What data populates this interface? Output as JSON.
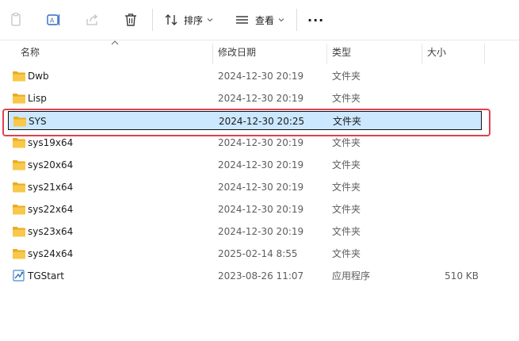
{
  "toolbar": {
    "copy_icon": "clipboard-icon",
    "rename_icon": "rename-icon",
    "share_icon": "share-icon",
    "delete_icon": "trash-icon",
    "sort_label": "排序",
    "view_label": "查看",
    "more_label": "···"
  },
  "columns": {
    "name": "名称",
    "date": "修改日期",
    "type": "类型",
    "size": "大小"
  },
  "files": [
    {
      "name": "Dwb",
      "date": "2024-12-30 20:19",
      "type": "文件夹",
      "size": "",
      "icon": "folder-icon"
    },
    {
      "name": "Lisp",
      "date": "2024-12-30 20:19",
      "type": "文件夹",
      "size": "",
      "icon": "folder-icon"
    },
    {
      "name": "SYS",
      "date": "2024-12-30 20:25",
      "type": "文件夹",
      "size": "",
      "icon": "folder-icon",
      "selected": true
    },
    {
      "name": "sys19x64",
      "date": "2024-12-30 20:19",
      "type": "文件夹",
      "size": "",
      "icon": "folder-icon"
    },
    {
      "name": "sys20x64",
      "date": "2024-12-30 20:19",
      "type": "文件夹",
      "size": "",
      "icon": "folder-icon"
    },
    {
      "name": "sys21x64",
      "date": "2024-12-30 20:19",
      "type": "文件夹",
      "size": "",
      "icon": "folder-icon"
    },
    {
      "name": "sys22x64",
      "date": "2024-12-30 20:19",
      "type": "文件夹",
      "size": "",
      "icon": "folder-icon"
    },
    {
      "name": "sys23x64",
      "date": "2024-12-30 20:19",
      "type": "文件夹",
      "size": "",
      "icon": "folder-icon"
    },
    {
      "name": "sys24x64",
      "date": "2025-02-14 8:55",
      "type": "文件夹",
      "size": "",
      "icon": "folder-icon"
    },
    {
      "name": "TGStart",
      "date": "2023-08-26 11:07",
      "type": "应用程序",
      "size": "510 KB",
      "icon": "app-icon"
    }
  ],
  "colors": {
    "folder": "#f8c84a",
    "selection": "#cce8ff",
    "highlight_border": "#e0414f"
  }
}
